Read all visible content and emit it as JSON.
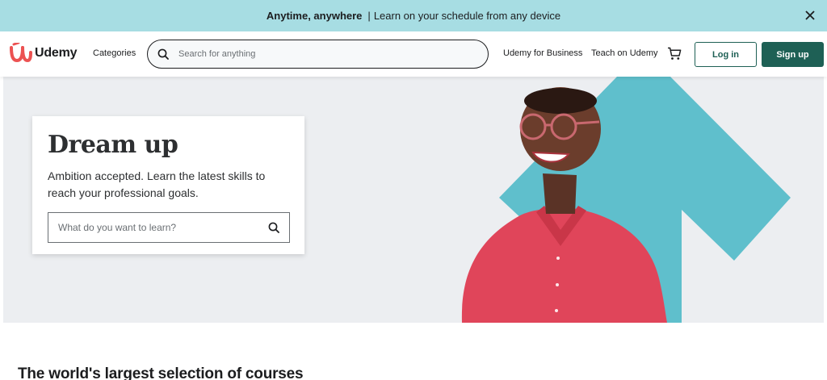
{
  "banner": {
    "headline": "Anytime, anywhere",
    "separator": "|",
    "message": "Learn on your schedule from any device",
    "close_icon": "close-icon"
  },
  "header": {
    "logo_text": "Udemy",
    "categories_label": "Categories",
    "search_placeholder": "Search for anything",
    "business_label": "Udemy for Business",
    "teach_label": "Teach on Udemy",
    "cart_icon": "cart-icon",
    "login_label": "Log in",
    "signup_label": "Sign up"
  },
  "hero": {
    "title": "Dream up",
    "subtitle": "Ambition accepted. Learn the latest skills to reach your professional goals.",
    "search_placeholder": "What do you want to learn?",
    "image": "smiling-woman-with-glasses-photo"
  },
  "section": {
    "heading": "The world's largest selection of courses"
  },
  "colors": {
    "banner_bg": "#a7dde3",
    "brand_red": "#ec5252",
    "primary_teal": "#1e6055",
    "hero_bg": "#eceef1",
    "arrow_teal": "#5fbfcc"
  }
}
